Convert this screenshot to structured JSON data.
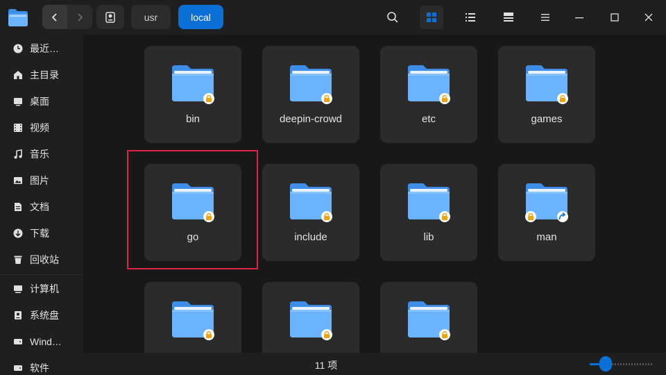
{
  "window": {
    "title_path": [
      "usr",
      "local"
    ]
  },
  "breadcrumb": {
    "segments": [
      {
        "label": "usr",
        "active": false
      },
      {
        "label": "local",
        "active": true
      }
    ]
  },
  "toolbar": {
    "icons": [
      "search-icon",
      "grid-view-icon",
      "list-view-icon",
      "tree-view-icon",
      "menu-icon",
      "minimize-icon",
      "maximize-icon",
      "close-icon"
    ],
    "active_view": "grid"
  },
  "sidebar": {
    "items": [
      {
        "label": "最近…",
        "icon": "clock-icon"
      },
      {
        "label": "主目录",
        "icon": "home-icon"
      },
      {
        "label": "桌面",
        "icon": "desktop-icon"
      },
      {
        "label": "视频",
        "icon": "video-icon"
      },
      {
        "label": "音乐",
        "icon": "music-icon"
      },
      {
        "label": "图片",
        "icon": "image-icon"
      },
      {
        "label": "文档",
        "icon": "document-icon"
      },
      {
        "label": "下载",
        "icon": "download-icon"
      },
      {
        "label": "回收站",
        "icon": "trash-icon"
      },
      {
        "label": "计算机",
        "icon": "computer-icon"
      },
      {
        "label": "系统盘",
        "icon": "disk-icon"
      },
      {
        "label": "Wind…",
        "icon": "disk-icon"
      },
      {
        "label": "软件",
        "icon": "disk-icon"
      }
    ]
  },
  "files": [
    {
      "name": "bin",
      "badge": "lock"
    },
    {
      "name": "deepin-crowd",
      "badge": "lock"
    },
    {
      "name": "etc",
      "badge": "lock"
    },
    {
      "name": "games",
      "badge": "lock"
    },
    {
      "name": "go",
      "badge": "lock",
      "highlighted": true
    },
    {
      "name": "include",
      "badge": "lock"
    },
    {
      "name": "lib",
      "badge": "lock"
    },
    {
      "name": "man",
      "badge": "lock-and-link"
    },
    {
      "name": "",
      "badge": "lock"
    },
    {
      "name": "",
      "badge": "lock"
    },
    {
      "name": "",
      "badge": "lock"
    }
  ],
  "status": {
    "item_count": "11 项",
    "zoom_level": 0.15
  },
  "colors": {
    "accent": "#0a6fd6",
    "highlight_border": "#e0224a",
    "lock_badge": "#f0a20f"
  }
}
